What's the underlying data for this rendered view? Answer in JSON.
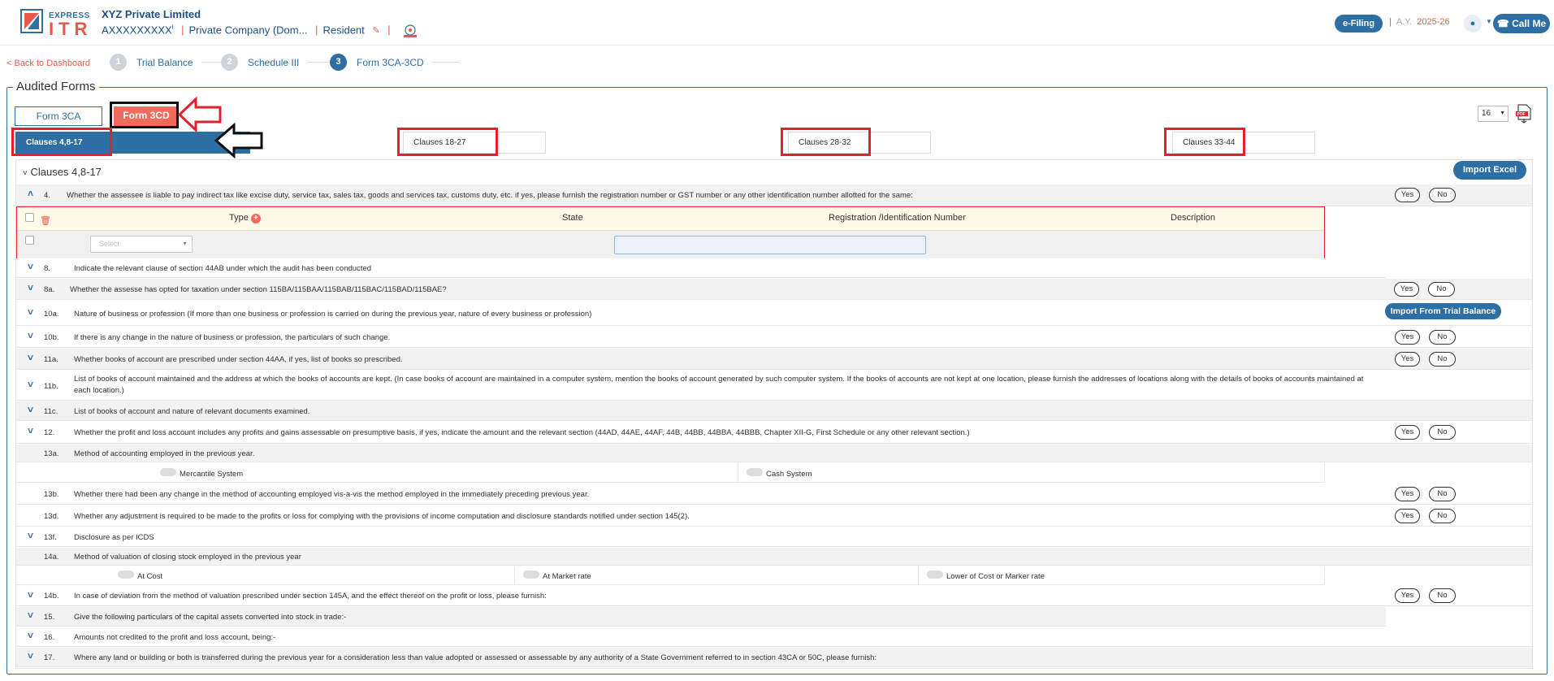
{
  "header": {
    "logo_top": "EXPRESS",
    "logo_bottom": "ITR",
    "company_name": "XYZ Private Limited",
    "pan": "AXXXXXXXXX",
    "pan_info": "i",
    "company_type": "Private Company (Dom...",
    "residency": "Resident",
    "efiling_label": "e-Filing",
    "ay_label": "A.Y.",
    "ay_value": "2025-26",
    "call_label": "Call Me",
    "colors": {
      "primary": "#2d6ea3",
      "accent": "#e8584c"
    }
  },
  "stepper": {
    "back_label": "< Back to Dashboard",
    "steps": [
      {
        "num": "1",
        "label": "Trial Balance"
      },
      {
        "num": "2",
        "label": "Schedule III"
      },
      {
        "num": "3",
        "label": "Form 3CA-3CD"
      }
    ]
  },
  "forms": {
    "legend": "Audited Forms",
    "tabs": [
      {
        "label": "Form 3CA"
      },
      {
        "label": "Form 3CD"
      }
    ],
    "page_select": "16",
    "subtabs": [
      {
        "label": "Clauses 4,8-17"
      },
      {
        "label": "Clauses 18-27"
      },
      {
        "label": "Clauses 28-32"
      },
      {
        "label": "Clauses 33-44"
      }
    ]
  },
  "panel": {
    "title": "Clauses 4,8-17",
    "import_excel": "Import Excel",
    "import_tb": "Import From Trial Balance",
    "yes": "Yes",
    "no": "No",
    "gst_table": {
      "headers": [
        "Type",
        "State",
        "Registration /Identification Number",
        "Description"
      ],
      "select_placeholder": "Select"
    },
    "rows": [
      {
        "num": "4.",
        "text": "Whether the assessee is liable to pay indirect tax like excise duty, service tax, sales tax, goods and services tax, customs duty, etc. if yes, please furnish the registration number or GST number or any other identification number allotted for the same:"
      },
      {
        "num": "8.",
        "text": "Indicate the relevant clause of section 44AB under which the audit has been conducted"
      },
      {
        "num": "8a.",
        "text": "Whether the assesse has opted for taxation under section 115BA/115BAA/115BAB/115BAC/115BAD/115BAE?"
      },
      {
        "num": "10a.",
        "text": "Nature of business or profession (If more than one business or profession is carried on during the previous year, nature of every business or profession)"
      },
      {
        "num": "10b.",
        "text": "If there is any change in the nature of business or profession, the particulars of such change."
      },
      {
        "num": "11a.",
        "text": "Whether books of account are prescribed under section 44AA, if yes, list of books so prescribed."
      },
      {
        "num": "11b.",
        "text": "List of books of account maintained and the address at which the books of accounts are kept. (In case books of account are maintained in a computer system, mention the books of account generated by such computer system. If the books of accounts are not kept at one location, please furnish the addresses of locations along with the details of books of accounts maintained at each location.)"
      },
      {
        "num": "11c.",
        "text": "List of books of account and nature of relevant documents examined."
      },
      {
        "num": "12.",
        "text": "Whether the profit and loss account includes any profits and gains assessable on presumptive basis, if yes, indicate the amount and the relevant section (44AD, 44AE, 44AF, 44B, 44BB, 44BBA, 44BBB, Chapter XII-G, First Schedule or any other relevant section.)"
      },
      {
        "num": "13a.",
        "text": "Method of accounting employed in the previous year."
      },
      {
        "num": "13b.",
        "text": "Whether there had been any change in the method of accounting employed vis-a-vis the method employed in the immediately preceding previous year."
      },
      {
        "num": "13d.",
        "text": "Whether any adjustment is required to be made to the profits or loss for complying with the provisions of income computation and disclosure standards notified under section 145(2)."
      },
      {
        "num": "13f.",
        "text": "Disclosure as per ICDS"
      },
      {
        "num": "14a.",
        "text": "Method of valuation of closing stock employed in the previous year"
      },
      {
        "num": "14b.",
        "text": "In case of deviation from the method of valuation prescribed under section 145A, and the effect thereof on the profit or loss, please furnish:"
      },
      {
        "num": "15.",
        "text": "Give the following particulars of the capital assets converted into stock in trade:-"
      },
      {
        "num": "16.",
        "text": "Amounts not credited to the profit and loss account, being:-"
      },
      {
        "num": "17.",
        "text": "Where any land or building or both is transferred during the previous year for a consideration less than value adopted or assessed or assessable by any authority of a State Government referred to in section 43CA or 50C, please furnish:"
      }
    ],
    "accounting_options": [
      "Mercantile System",
      "Cash System"
    ],
    "valuation_options": [
      "At Cost",
      "At Market rate",
      "Lower of Cost or Marker rate"
    ]
  }
}
